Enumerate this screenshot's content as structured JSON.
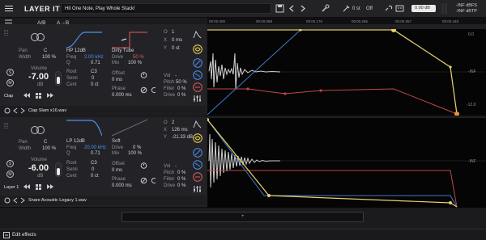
{
  "app": {
    "title": "LAYER IT",
    "preset_name": "Hit One Note, Play Whole Stack!",
    "transpose_value": "0 st",
    "transpose_state": "Off",
    "output_value": "0.00 dB",
    "meter_lines": [
      "-INF dBFS",
      "-INF dBTP"
    ],
    "toolbar": {
      "ab_label": "A/B",
      "a_to_b_label": "A→B"
    },
    "accent_color": "#4b8ef0",
    "red_color": "#e05a5a",
    "yellow_color": "#e8d06a"
  },
  "timeline": {
    "ticks": [
      "00:00.000",
      "00:00.088",
      "00:00.176",
      "00:00.265",
      "00:00.357",
      "00:00.448"
    ],
    "sub_ticks": [
      "1.2.2",
      "1.2.3",
      "1.2.4",
      "1.3"
    ],
    "db_scale": [
      "0.0",
      "-12.0",
      "-INF"
    ]
  },
  "layers": [
    {
      "name": "Clap",
      "filename": "Clap Slam x16.wav",
      "pan_label": "Pan",
      "pan_value": "C",
      "width_label": "Width",
      "width_value": "100 %",
      "volume_label": "Volume",
      "volume_value": "-7.00",
      "volume_unit": "dB",
      "filter_label": "HP 12dB",
      "freq_label": "Freq",
      "freq_value": "2.00 kHz",
      "q_label": "Q",
      "q_value": "0.71",
      "drive_type": "Dirty Tube",
      "drive_label": "Drive",
      "drive_value": "50 %",
      "mix_label": "Mix",
      "mix_value": "100 %",
      "root_label": "Root",
      "root_value": "C3",
      "semi_label": "Semi",
      "semi_value": "0",
      "cent_label": "Cent",
      "cent_value": "0 ct",
      "offset_label": "Offset",
      "offset_value": "0 ms",
      "phase_label": "Phase",
      "phase_value": "0.000 ms",
      "o_label": "O",
      "o_value": "1",
      "x_label": "X",
      "x_value": "0 ms",
      "y_label": "Y",
      "y_value": "0 st",
      "vol_label": "Vol",
      "vol_value": "-",
      "pitch_label": "Pitch",
      "pitch_value": "50 %",
      "filter2_label": "Filter",
      "filter2_value": "0 %",
      "drive2_label": "Drive",
      "drive2_value": "0 %"
    },
    {
      "name": "Layer 1",
      "filename": "Snare Acoustic Legacy 1.wav",
      "pan_label": "Pan",
      "pan_value": "C",
      "width_label": "Width",
      "width_value": "100 %",
      "volume_label": "Volume",
      "volume_value": "-6.00",
      "volume_unit": "dB",
      "filter_label": "LP 12dB",
      "freq_label": "Freq",
      "freq_value": "20.00 kHz",
      "q_label": "Q",
      "q_value": "0.71",
      "drive_type": "Soft",
      "drive_label": "Drive",
      "drive_value": "0 %",
      "mix_label": "Mix",
      "mix_value": "100 %",
      "root_label": "Root",
      "root_value": "C3",
      "semi_label": "Semi",
      "semi_value": "0",
      "cent_label": "Cent",
      "cent_value": "0 ct",
      "offset_label": "Offset",
      "offset_value": "0 ms",
      "phase_label": "Phase",
      "phase_value": "0.000 ms",
      "o_label": "O",
      "o_value": "2",
      "x_label": "X",
      "x_value": "126 ms",
      "y_label": "Y",
      "y_value": "-21.33 dB",
      "vol_label": "Vol",
      "vol_value": "-",
      "pitch_label": "Pitch",
      "pitch_value": "0 %",
      "filter2_label": "Filter",
      "filter2_value": "0 %",
      "drive2_label": "Drive",
      "drive2_value": "0 %"
    }
  ],
  "bottom": {
    "edit_effects_label": "Edit effects",
    "add_layer_symbol": "+"
  }
}
